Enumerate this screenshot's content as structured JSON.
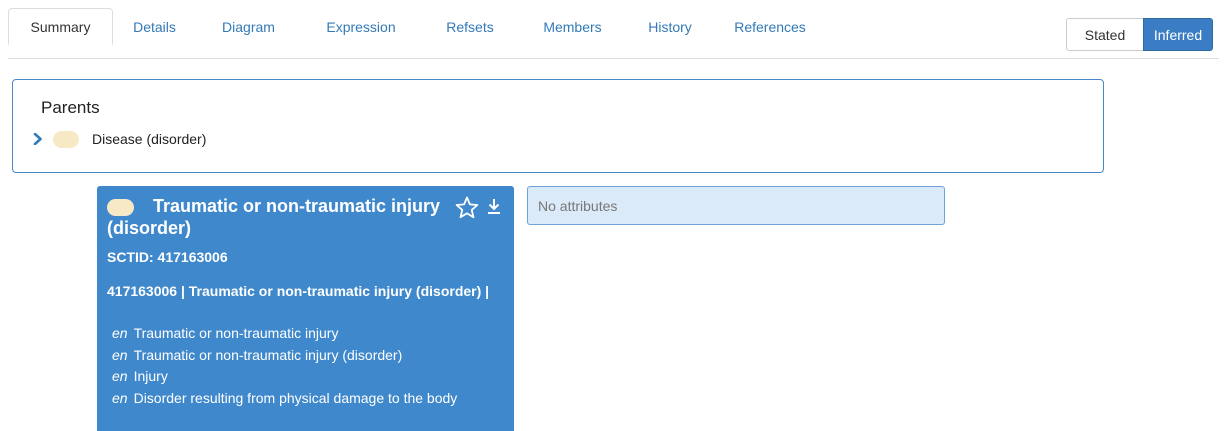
{
  "tabs": [
    {
      "label": "Summary",
      "active": true
    },
    {
      "label": "Details",
      "active": false
    },
    {
      "label": "Diagram",
      "active": false
    },
    {
      "label": "Expression",
      "active": false
    },
    {
      "label": "Refsets",
      "active": false
    },
    {
      "label": "Members",
      "active": false
    },
    {
      "label": "History",
      "active": false
    },
    {
      "label": "References",
      "active": false
    }
  ],
  "view_toggle": {
    "stated_label": "Stated",
    "inferred_label": "Inferred",
    "selected": "Inferred"
  },
  "parents": {
    "title": "Parents",
    "items": [
      {
        "label": "Disease (disorder)"
      }
    ]
  },
  "concept": {
    "title": "Traumatic or non-traumatic injury (disorder)",
    "sctid_line": "SCTID: 417163006",
    "fsn_line": "417163006 | Traumatic or non-traumatic injury (disorder) |",
    "descriptions": [
      {
        "lang": "en",
        "text": "Traumatic or non-traumatic injury"
      },
      {
        "lang": "en",
        "text": "Traumatic or non-traumatic injury (disorder)"
      },
      {
        "lang": "en",
        "text": "Injury"
      },
      {
        "lang": "en",
        "text": "Disorder resulting from physical damage to the body"
      }
    ]
  },
  "attributes": {
    "empty_text": "No attributes"
  },
  "colors": {
    "link": "#337ab7",
    "accent": "#3b7dc4",
    "card_background": "#3f88cc",
    "attributes_background": "#dbeaf8",
    "pill": "#f7e9c6"
  },
  "icons": {
    "parent_expand": "chevron-right-icon",
    "favorite": "star-icon",
    "download": "download-icon"
  }
}
